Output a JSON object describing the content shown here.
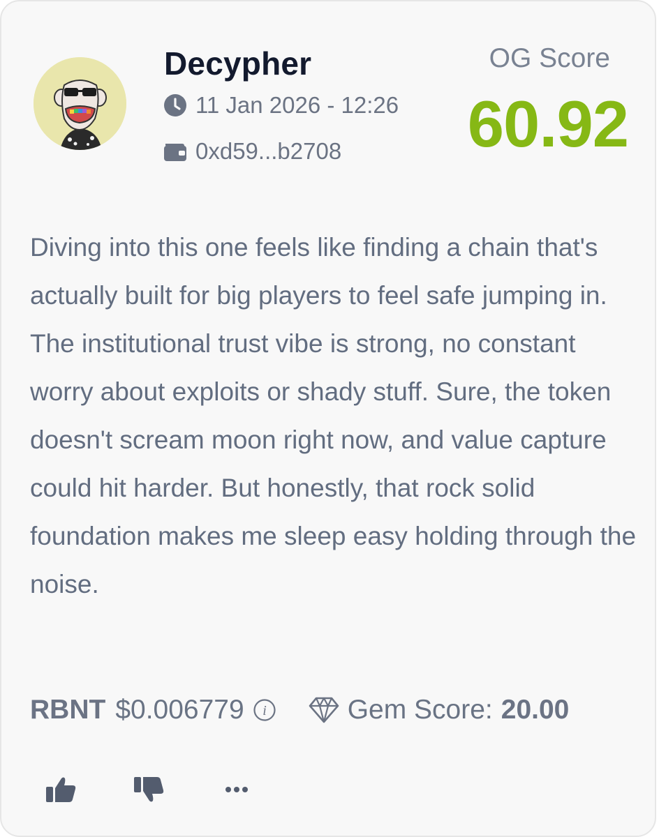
{
  "post": {
    "username": "Decypher",
    "timestamp": "11 Jan 2026 - 12:26",
    "wallet": "0xd59...b2708",
    "og_label": "OG Score",
    "og_value": "60.92",
    "review": "Diving into this one feels like finding a chain that's actually built for big players to feel safe jumping in. The institutional trust vibe is strong, no constant worry about exploits or shady stuff. Sure, the token doesn't scream moon right now, and value capture could hit harder. But honestly, that rock solid foundation makes me sleep easy holding through the noise."
  },
  "token": {
    "symbol": "RBNT",
    "price": "$0.006779",
    "gem_label": "Gem Score:",
    "gem_value": "20.00"
  },
  "icons": {
    "time": "clock-icon",
    "wallet": "wallet-icon",
    "info": "info-icon",
    "gem": "diamond-icon",
    "like": "thumbs-up-icon",
    "dislike": "thumbs-down-icon",
    "more": "ellipsis-icon"
  },
  "colors": {
    "og_score": "#86b815",
    "text_primary": "#131a2e",
    "text_muted": "#626d80",
    "card_background": "#f8f8f8"
  }
}
